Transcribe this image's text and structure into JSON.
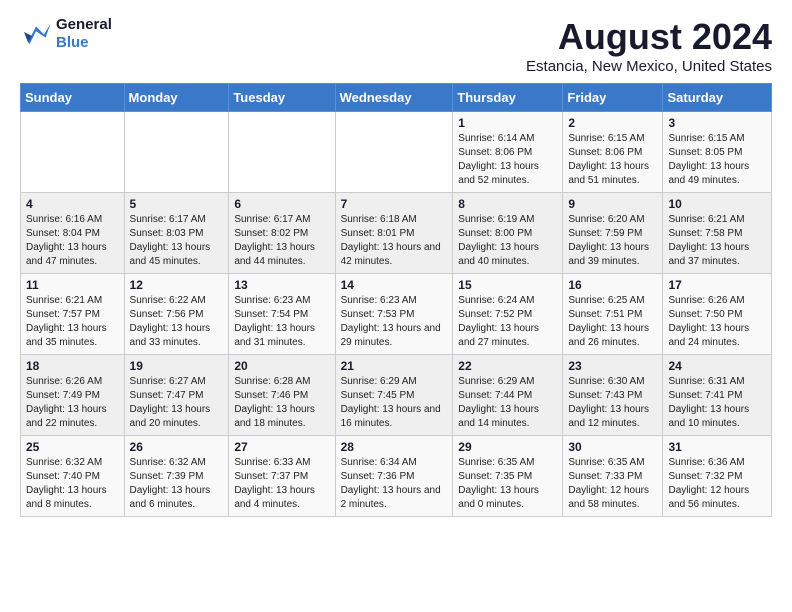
{
  "logo": {
    "line1": "General",
    "line2": "Blue"
  },
  "title": "August 2024",
  "subtitle": "Estancia, New Mexico, United States",
  "days_header": [
    "Sunday",
    "Monday",
    "Tuesday",
    "Wednesday",
    "Thursday",
    "Friday",
    "Saturday"
  ],
  "weeks": [
    [
      {
        "num": "",
        "sunrise": "",
        "sunset": "",
        "daylight": ""
      },
      {
        "num": "",
        "sunrise": "",
        "sunset": "",
        "daylight": ""
      },
      {
        "num": "",
        "sunrise": "",
        "sunset": "",
        "daylight": ""
      },
      {
        "num": "",
        "sunrise": "",
        "sunset": "",
        "daylight": ""
      },
      {
        "num": "1",
        "sunrise": "Sunrise: 6:14 AM",
        "sunset": "Sunset: 8:06 PM",
        "daylight": "Daylight: 13 hours and 52 minutes."
      },
      {
        "num": "2",
        "sunrise": "Sunrise: 6:15 AM",
        "sunset": "Sunset: 8:06 PM",
        "daylight": "Daylight: 13 hours and 51 minutes."
      },
      {
        "num": "3",
        "sunrise": "Sunrise: 6:15 AM",
        "sunset": "Sunset: 8:05 PM",
        "daylight": "Daylight: 13 hours and 49 minutes."
      }
    ],
    [
      {
        "num": "4",
        "sunrise": "Sunrise: 6:16 AM",
        "sunset": "Sunset: 8:04 PM",
        "daylight": "Daylight: 13 hours and 47 minutes."
      },
      {
        "num": "5",
        "sunrise": "Sunrise: 6:17 AM",
        "sunset": "Sunset: 8:03 PM",
        "daylight": "Daylight: 13 hours and 45 minutes."
      },
      {
        "num": "6",
        "sunrise": "Sunrise: 6:17 AM",
        "sunset": "Sunset: 8:02 PM",
        "daylight": "Daylight: 13 hours and 44 minutes."
      },
      {
        "num": "7",
        "sunrise": "Sunrise: 6:18 AM",
        "sunset": "Sunset: 8:01 PM",
        "daylight": "Daylight: 13 hours and 42 minutes."
      },
      {
        "num": "8",
        "sunrise": "Sunrise: 6:19 AM",
        "sunset": "Sunset: 8:00 PM",
        "daylight": "Daylight: 13 hours and 40 minutes."
      },
      {
        "num": "9",
        "sunrise": "Sunrise: 6:20 AM",
        "sunset": "Sunset: 7:59 PM",
        "daylight": "Daylight: 13 hours and 39 minutes."
      },
      {
        "num": "10",
        "sunrise": "Sunrise: 6:21 AM",
        "sunset": "Sunset: 7:58 PM",
        "daylight": "Daylight: 13 hours and 37 minutes."
      }
    ],
    [
      {
        "num": "11",
        "sunrise": "Sunrise: 6:21 AM",
        "sunset": "Sunset: 7:57 PM",
        "daylight": "Daylight: 13 hours and 35 minutes."
      },
      {
        "num": "12",
        "sunrise": "Sunrise: 6:22 AM",
        "sunset": "Sunset: 7:56 PM",
        "daylight": "Daylight: 13 hours and 33 minutes."
      },
      {
        "num": "13",
        "sunrise": "Sunrise: 6:23 AM",
        "sunset": "Sunset: 7:54 PM",
        "daylight": "Daylight: 13 hours and 31 minutes."
      },
      {
        "num": "14",
        "sunrise": "Sunrise: 6:23 AM",
        "sunset": "Sunset: 7:53 PM",
        "daylight": "Daylight: 13 hours and 29 minutes."
      },
      {
        "num": "15",
        "sunrise": "Sunrise: 6:24 AM",
        "sunset": "Sunset: 7:52 PM",
        "daylight": "Daylight: 13 hours and 27 minutes."
      },
      {
        "num": "16",
        "sunrise": "Sunrise: 6:25 AM",
        "sunset": "Sunset: 7:51 PM",
        "daylight": "Daylight: 13 hours and 26 minutes."
      },
      {
        "num": "17",
        "sunrise": "Sunrise: 6:26 AM",
        "sunset": "Sunset: 7:50 PM",
        "daylight": "Daylight: 13 hours and 24 minutes."
      }
    ],
    [
      {
        "num": "18",
        "sunrise": "Sunrise: 6:26 AM",
        "sunset": "Sunset: 7:49 PM",
        "daylight": "Daylight: 13 hours and 22 minutes."
      },
      {
        "num": "19",
        "sunrise": "Sunrise: 6:27 AM",
        "sunset": "Sunset: 7:47 PM",
        "daylight": "Daylight: 13 hours and 20 minutes."
      },
      {
        "num": "20",
        "sunrise": "Sunrise: 6:28 AM",
        "sunset": "Sunset: 7:46 PM",
        "daylight": "Daylight: 13 hours and 18 minutes."
      },
      {
        "num": "21",
        "sunrise": "Sunrise: 6:29 AM",
        "sunset": "Sunset: 7:45 PM",
        "daylight": "Daylight: 13 hours and 16 minutes."
      },
      {
        "num": "22",
        "sunrise": "Sunrise: 6:29 AM",
        "sunset": "Sunset: 7:44 PM",
        "daylight": "Daylight: 13 hours and 14 minutes."
      },
      {
        "num": "23",
        "sunrise": "Sunrise: 6:30 AM",
        "sunset": "Sunset: 7:43 PM",
        "daylight": "Daylight: 13 hours and 12 minutes."
      },
      {
        "num": "24",
        "sunrise": "Sunrise: 6:31 AM",
        "sunset": "Sunset: 7:41 PM",
        "daylight": "Daylight: 13 hours and 10 minutes."
      }
    ],
    [
      {
        "num": "25",
        "sunrise": "Sunrise: 6:32 AM",
        "sunset": "Sunset: 7:40 PM",
        "daylight": "Daylight: 13 hours and 8 minutes."
      },
      {
        "num": "26",
        "sunrise": "Sunrise: 6:32 AM",
        "sunset": "Sunset: 7:39 PM",
        "daylight": "Daylight: 13 hours and 6 minutes."
      },
      {
        "num": "27",
        "sunrise": "Sunrise: 6:33 AM",
        "sunset": "Sunset: 7:37 PM",
        "daylight": "Daylight: 13 hours and 4 minutes."
      },
      {
        "num": "28",
        "sunrise": "Sunrise: 6:34 AM",
        "sunset": "Sunset: 7:36 PM",
        "daylight": "Daylight: 13 hours and 2 minutes."
      },
      {
        "num": "29",
        "sunrise": "Sunrise: 6:35 AM",
        "sunset": "Sunset: 7:35 PM",
        "daylight": "Daylight: 13 hours and 0 minutes."
      },
      {
        "num": "30",
        "sunrise": "Sunrise: 6:35 AM",
        "sunset": "Sunset: 7:33 PM",
        "daylight": "Daylight: 12 hours and 58 minutes."
      },
      {
        "num": "31",
        "sunrise": "Sunrise: 6:36 AM",
        "sunset": "Sunset: 7:32 PM",
        "daylight": "Daylight: 12 hours and 56 minutes."
      }
    ]
  ]
}
